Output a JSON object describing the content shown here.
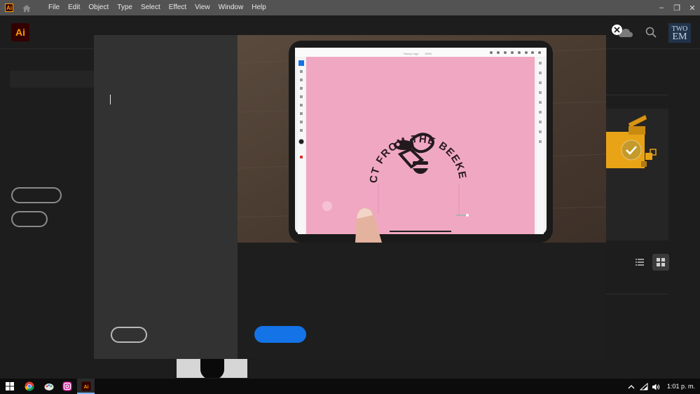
{
  "menubar": {
    "app_badge": "Ai",
    "items": [
      "File",
      "Edit",
      "Object",
      "Type",
      "Select",
      "Effect",
      "View",
      "Window",
      "Help"
    ]
  },
  "header": {
    "logo": "Ai",
    "avatar_line1": "TWO",
    "avatar_line2": "EM"
  },
  "modal": {
    "video": {
      "badge_text": "DIRECT FROM THE BEEKEEPER"
    }
  },
  "taskbar": {
    "clock": "1:01 p. m.",
    "icons": [
      "windows-start-icon",
      "chrome-icon",
      "paint-app-icon",
      "instagram-app-icon",
      "illustrator-app-icon"
    ]
  },
  "colors": {
    "accent_blue": "#1473e6",
    "artboard_pink": "#f0a8c2",
    "ai_orange": "#ff9a00"
  }
}
